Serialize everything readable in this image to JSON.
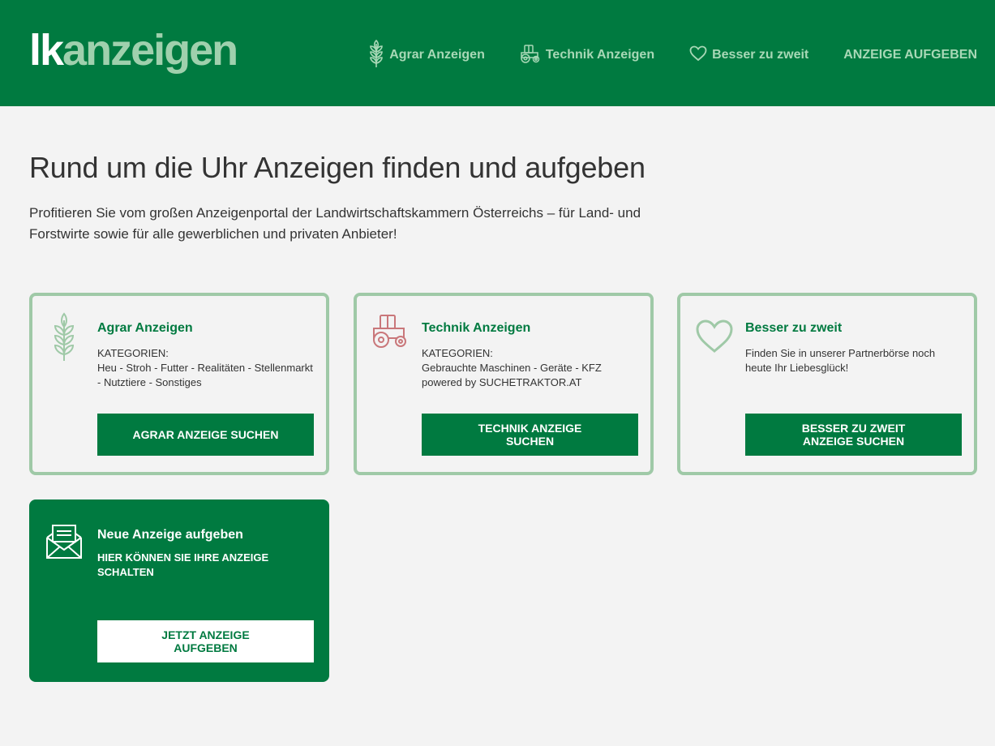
{
  "header": {
    "logo_lk": "lk",
    "logo_rest": "anzeigen",
    "nav": [
      {
        "label": "Agrar Anzeigen",
        "icon": "wheat-icon"
      },
      {
        "label": "Technik Anzeigen",
        "icon": "tractor-icon"
      },
      {
        "label": "Besser zu zweit",
        "icon": "heart-icon"
      },
      {
        "label": "ANZEIGE AUFGEBEN"
      }
    ]
  },
  "main": {
    "headline": "Rund um die Uhr Anzeigen finden und aufgeben",
    "intro": "Profitieren Sie vom großen Anzeigenportal der Landwirtschaftskammern Österreichs – für Land- und Forstwirte sowie für alle gewerblichen und privaten Anbieter!"
  },
  "cards": [
    {
      "title": "Agrar Anzeigen",
      "label": "KATEGORIEN:",
      "text": "Heu - Stroh - Futter - Realitäten - Stellenmarkt - Nutztiere - Sonstiges",
      "button": "AGRAR ANZEIGE SUCHEN",
      "icon": "wheat-icon"
    },
    {
      "title": "Technik Anzeigen",
      "label": "KATEGORIEN:",
      "text": "Gebrauchte Maschinen - Geräte - KFZ powered by SUCHETRAKTOR.AT",
      "button": "TECHNIK ANZEIGE SUCHEN",
      "icon": "tractor-icon"
    },
    {
      "title": "Besser zu zweit",
      "text": "Finden Sie in unserer Partnerbörse noch heute Ihr Liebesglück!",
      "button": "BESSER ZU ZWEIT ANZEIGE SUCHEN",
      "icon": "heart-icon"
    },
    {
      "title": "Neue Anzeige aufgeben",
      "text": "HIER KÖNNEN SIE IHRE ANZEIGE SCHALTEN",
      "button": "JETZT ANZEIGE AUFGEBEN",
      "icon": "envelope-icon"
    }
  ],
  "colors": {
    "brand_green": "#007a40",
    "light_green": "#9fc9a7",
    "nav_text": "#a8d8b6",
    "tractor_red": "#c9777a",
    "background": "#f3f3f3"
  }
}
